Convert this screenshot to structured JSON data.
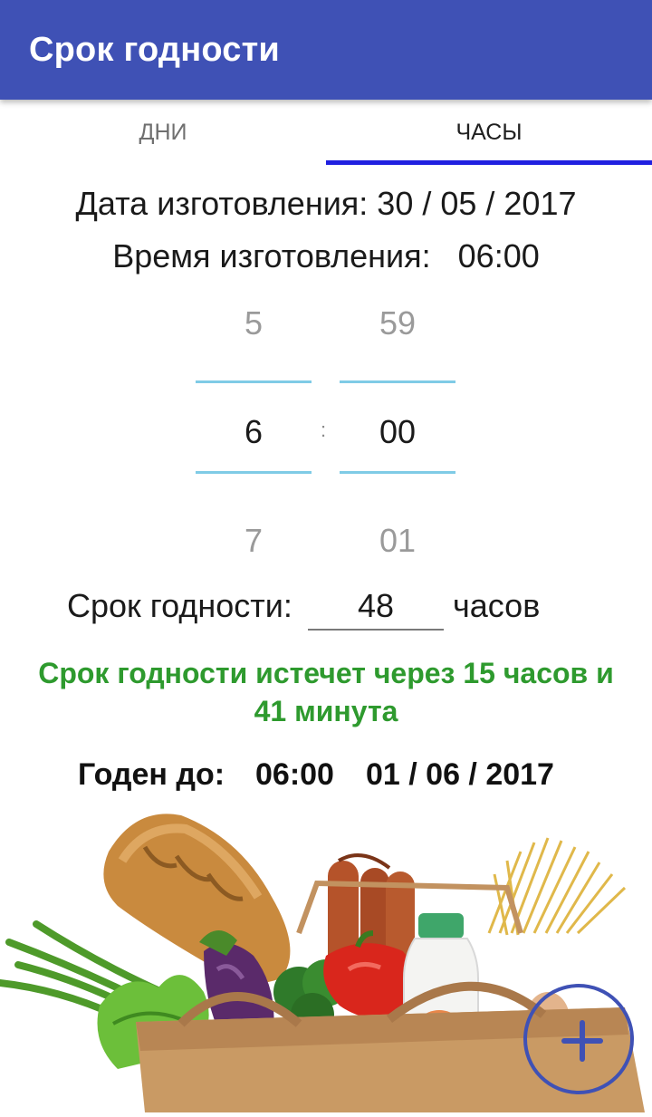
{
  "app": {
    "title": "Срок годности"
  },
  "tabs": {
    "days": "ДНИ",
    "hours": "ЧАСЫ",
    "active": "hours"
  },
  "manufacture": {
    "date_line": "Дата изготовления: 30 / 05 / 2017",
    "time_line": "Время изготовления:   06:00"
  },
  "picker": {
    "hours": {
      "prev": "5",
      "selected": "6",
      "next": "7"
    },
    "separator": ":",
    "minutes": {
      "prev": "59",
      "selected": "00",
      "next": "01"
    }
  },
  "shelf_life": {
    "label": "Срок годности:",
    "value": "48",
    "unit": "часов"
  },
  "expire_message": {
    "line1": "Срок годности истечет через 15 часов и",
    "line2": "41 минута"
  },
  "good_until": {
    "label": "Годен до:",
    "time": "06:00",
    "date": "01 / 06 / 2017"
  },
  "colors": {
    "appbar": "#3f51b5",
    "tab_indicator": "#1f1fe0",
    "picker_divider": "#7fcbe6",
    "expire_text": "#2e9a2e",
    "fab_border": "#3f51b5"
  },
  "icons": {
    "fab": "plus-icon",
    "illustration": "grocery-bag-illustration"
  }
}
